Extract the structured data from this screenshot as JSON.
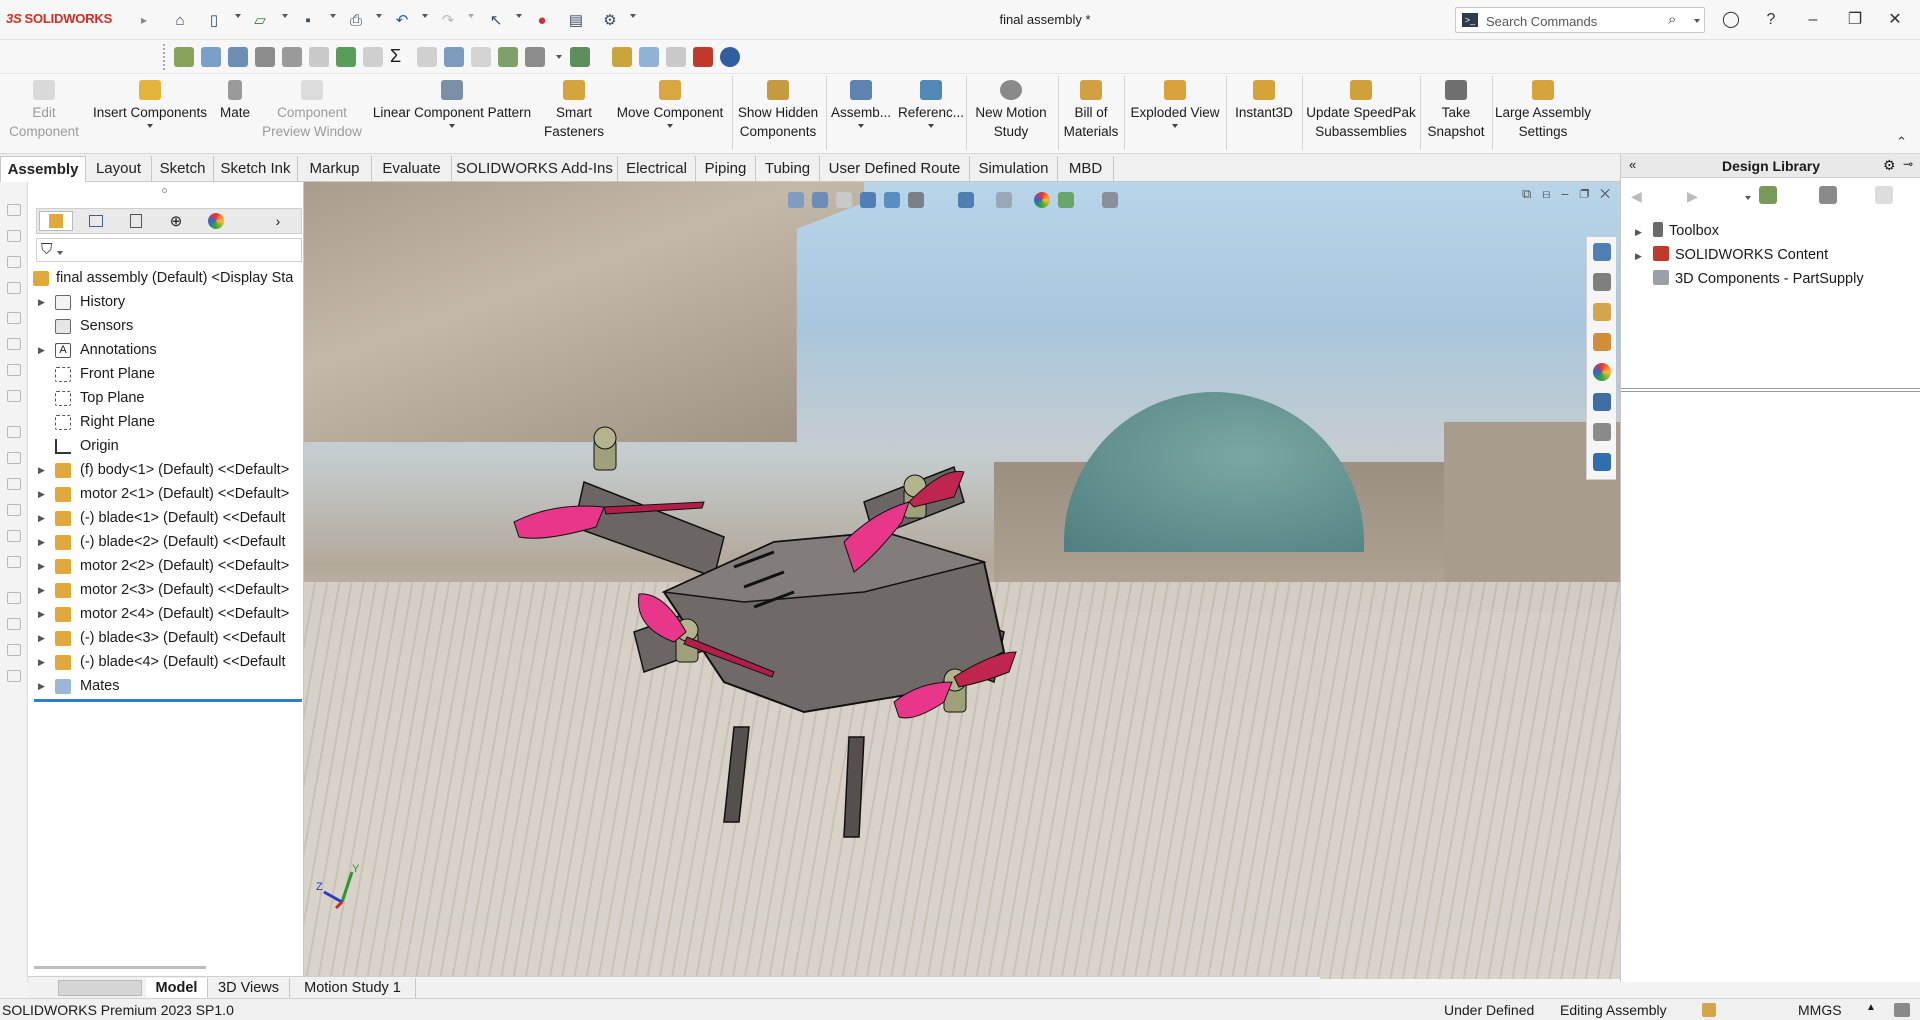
{
  "app": {
    "brand": "SOLIDWORKS",
    "document_title": "final assembly *"
  },
  "search": {
    "placeholder": "Search Commands"
  },
  "command_manager": {
    "buttons": [
      {
        "label": "Edit Component",
        "enabled": false
      },
      {
        "label": "Insert Components",
        "enabled": true
      },
      {
        "label": "Mate",
        "enabled": true
      },
      {
        "label": "Component Preview Window",
        "enabled": false
      },
      {
        "label": "Linear Component Pattern",
        "enabled": true
      },
      {
        "label": "Smart Fasteners",
        "enabled": true
      },
      {
        "label": "Move Component",
        "enabled": true
      },
      {
        "label": "Show Hidden Components",
        "enabled": true
      },
      {
        "label": "Assemb...",
        "enabled": true
      },
      {
        "label": "Referenc...",
        "enabled": true
      },
      {
        "label": "New Motion Study",
        "enabled": true
      },
      {
        "label": "Bill of Materials",
        "enabled": true
      },
      {
        "label": "Exploded View",
        "enabled": true
      },
      {
        "label": "Instant3D",
        "enabled": true
      },
      {
        "label": "Update SpeedPak Subassemblies",
        "enabled": true
      },
      {
        "label": "Take Snapshot",
        "enabled": true
      },
      {
        "label": "Large Assembly Settings",
        "enabled": true
      }
    ]
  },
  "tabs": [
    "Assembly",
    "Layout",
    "Sketch",
    "Sketch Ink",
    "Markup",
    "Evaluate",
    "SOLIDWORKS Add-Ins",
    "Electrical",
    "Piping",
    "Tubing",
    "User Defined Route",
    "Simulation",
    "MBD"
  ],
  "active_tab": "Assembly",
  "feature_tree": {
    "root": "final assembly (Default) <Display Sta",
    "items": [
      {
        "label": "History",
        "expandable": true
      },
      {
        "label": "Sensors",
        "expandable": false
      },
      {
        "label": "Annotations",
        "expandable": true
      },
      {
        "label": "Front Plane",
        "expandable": false
      },
      {
        "label": "Top Plane",
        "expandable": false
      },
      {
        "label": "Right Plane",
        "expandable": false
      },
      {
        "label": "Origin",
        "expandable": false
      },
      {
        "label": "(f) body<1> (Default) <<Default>",
        "expandable": true
      },
      {
        "label": "motor 2<1> (Default) <<Default>",
        "expandable": true
      },
      {
        "label": "(-) blade<1> (Default) <<Default",
        "expandable": true
      },
      {
        "label": "(-) blade<2> (Default) <<Default",
        "expandable": true
      },
      {
        "label": "motor 2<2> (Default) <<Default>",
        "expandable": true
      },
      {
        "label": "motor 2<3> (Default) <<Default>",
        "expandable": true
      },
      {
        "label": "motor 2<4> (Default) <<Default>",
        "expandable": true
      },
      {
        "label": "(-) blade<3> (Default) <<Default",
        "expandable": true
      },
      {
        "label": "(-) blade<4> (Default) <<Default",
        "expandable": true
      },
      {
        "label": "Mates",
        "expandable": true
      }
    ]
  },
  "task_pane": {
    "title": "Design Library",
    "items": [
      {
        "label": "Toolbox"
      },
      {
        "label": "SOLIDWORKS Content"
      },
      {
        "label": "3D Components - PartSupply"
      }
    ]
  },
  "bottom_tabs": [
    "Model",
    "3D Views",
    "Motion Study 1"
  ],
  "active_bottom_tab": "Model",
  "status": {
    "version": "SOLIDWORKS Premium 2023 SP1.0",
    "definition": "Under Defined",
    "mode": "Editing Assembly",
    "units": "MMGS"
  },
  "triad": {
    "x": "X",
    "y": "Y",
    "z": "Z"
  },
  "colors": {
    "blade": "#e8368a",
    "body": "#6b6664",
    "accent": "#d52b1e",
    "selection_bar": "#2d7ed0"
  }
}
